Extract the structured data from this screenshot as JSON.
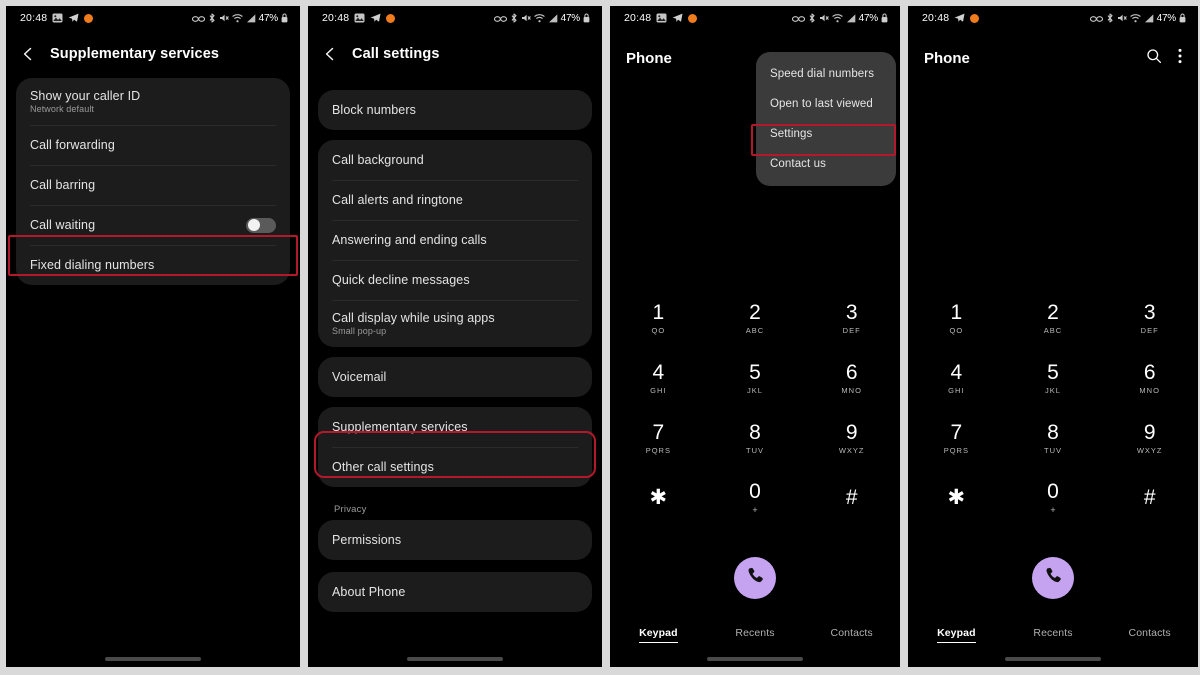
{
  "status_bar": {
    "time": "20:48",
    "battery": "47%",
    "left_icons": [
      "image-icon",
      "telegram-icon",
      "orange-dot-icon"
    ],
    "right_icons": [
      "dnd-glasses-icon",
      "bluetooth-icon",
      "mute-icon",
      "wifi-icon",
      "signal-icon"
    ],
    "lock_icon": "lock-icon"
  },
  "colors": {
    "accent": "#c5a3f0",
    "highlight": "#b4192b",
    "card": "#1c1c1c",
    "menu": "#3b3b3b",
    "orange_dot": "#f07c1e"
  },
  "panel1": {
    "title": "Supplementary services",
    "back_icon": "back-chevron-icon",
    "items": [
      {
        "label": "Show your caller ID",
        "sub": "Network default",
        "toggle": null
      },
      {
        "label": "Call forwarding",
        "sub": "",
        "toggle": null
      },
      {
        "label": "Call barring",
        "sub": "",
        "toggle": null
      },
      {
        "label": "Call waiting",
        "sub": "",
        "toggle": "off"
      },
      {
        "label": "Fixed dialing numbers",
        "sub": "",
        "toggle": null
      }
    ],
    "highlighted_item": "Call waiting"
  },
  "panel2": {
    "title": "Call settings",
    "back_icon": "back-chevron-icon",
    "groups": [
      {
        "header": "",
        "items": [
          {
            "label": "Block numbers",
            "sub": ""
          }
        ]
      },
      {
        "header": "",
        "items": [
          {
            "label": "Call background",
            "sub": ""
          },
          {
            "label": "Call alerts and ringtone",
            "sub": ""
          },
          {
            "label": "Answering and ending calls",
            "sub": ""
          },
          {
            "label": "Quick decline messages",
            "sub": ""
          },
          {
            "label": "Call display while using apps",
            "sub": "Small pop-up"
          }
        ]
      },
      {
        "header": "",
        "items": [
          {
            "label": "Voicemail",
            "sub": ""
          }
        ]
      },
      {
        "header": "",
        "items": [
          {
            "label": "Supplementary services",
            "sub": ""
          },
          {
            "label": "Other call settings",
            "sub": ""
          }
        ]
      },
      {
        "header": "Privacy",
        "items": [
          {
            "label": "Permissions",
            "sub": ""
          }
        ]
      },
      {
        "header": "",
        "items": [
          {
            "label": "About Phone",
            "sub": ""
          }
        ]
      }
    ],
    "highlighted_item": "Supplementary services"
  },
  "panel3": {
    "title": "Phone",
    "menu": {
      "items": [
        "Speed dial numbers",
        "Open to last viewed",
        "Settings",
        "Contact us"
      ],
      "highlighted_item": "Settings"
    },
    "dialpad": [
      {
        "num": "1",
        "sub": "QO"
      },
      {
        "num": "2",
        "sub": "ABC"
      },
      {
        "num": "3",
        "sub": "DEF"
      },
      {
        "num": "4",
        "sub": "GHI"
      },
      {
        "num": "5",
        "sub": "JKL"
      },
      {
        "num": "6",
        "sub": "MNO"
      },
      {
        "num": "7",
        "sub": "PQRS"
      },
      {
        "num": "8",
        "sub": "TUV"
      },
      {
        "num": "9",
        "sub": "WXYZ"
      },
      {
        "num": "✱",
        "sub": ""
      },
      {
        "num": "0",
        "sub": "+"
      },
      {
        "num": "#",
        "sub": ""
      }
    ],
    "call_button_icon": "phone-call-icon",
    "tabs": [
      {
        "label": "Keypad",
        "active": true
      },
      {
        "label": "Recents",
        "active": false
      },
      {
        "label": "Contacts",
        "active": false
      }
    ]
  },
  "panel4": {
    "title": "Phone",
    "search_icon": "search-icon",
    "overflow_icon": "more-vertical-icon",
    "dialpad": [
      {
        "num": "1",
        "sub": "QO"
      },
      {
        "num": "2",
        "sub": "ABC"
      },
      {
        "num": "3",
        "sub": "DEF"
      },
      {
        "num": "4",
        "sub": "GHI"
      },
      {
        "num": "5",
        "sub": "JKL"
      },
      {
        "num": "6",
        "sub": "MNO"
      },
      {
        "num": "7",
        "sub": "PQRS"
      },
      {
        "num": "8",
        "sub": "TUV"
      },
      {
        "num": "9",
        "sub": "WXYZ"
      },
      {
        "num": "✱",
        "sub": ""
      },
      {
        "num": "0",
        "sub": "+"
      },
      {
        "num": "#",
        "sub": ""
      }
    ],
    "call_button_icon": "phone-call-icon",
    "tabs": [
      {
        "label": "Keypad",
        "active": true
      },
      {
        "label": "Recents",
        "active": false
      },
      {
        "label": "Contacts",
        "active": false
      }
    ]
  }
}
